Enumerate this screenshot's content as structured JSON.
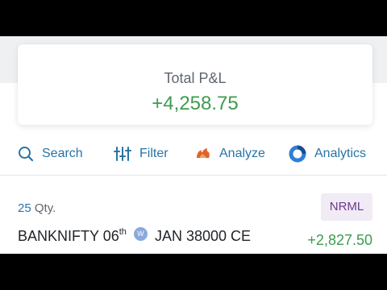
{
  "summary": {
    "label": "Total P&L",
    "value": "+4,258.75"
  },
  "toolbar": {
    "search": "Search",
    "filter": "Filter",
    "analyze": "Analyze",
    "analytics": "Analytics"
  },
  "position": {
    "qty_number": "25",
    "qty_unit": "Qty.",
    "product": "NRML",
    "symbol": "BANKNIFTY 06",
    "day_suffix": "th",
    "weekly_badge": "W",
    "contract": "JAN 38000 CE",
    "pnl": "+2,827.50"
  },
  "colors": {
    "accent": "#2874a6",
    "profit": "#3f9b4f",
    "analyze_icon": "#e2622b",
    "analytics_icon": "#2f7fd6",
    "product_tag_bg": "#f1ebf6",
    "product_tag_text": "#6b3b8c"
  },
  "icons": {
    "search": "search-icon",
    "filter": "filter-sliders-icon",
    "analyze": "analyze-flame-icon",
    "analytics": "analytics-ring-icon"
  }
}
